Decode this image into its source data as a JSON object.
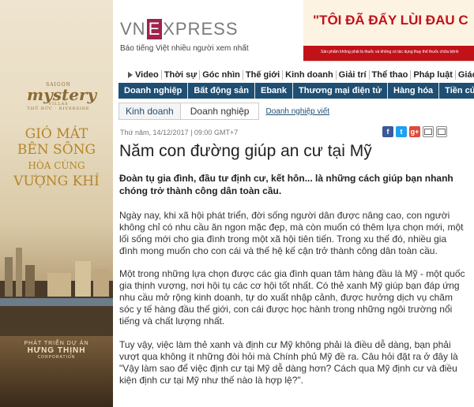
{
  "left_ad": {
    "brand_small": "SAIGON",
    "brand_script": "mystery",
    "brand_tag": "VILLAS",
    "brand_sub": "THỦ ĐỨC · RIVERSIDE",
    "slogan": [
      "GIÓ MÁT",
      "BÊN SÔNG",
      "HÒA CÙNG",
      "VƯỢNG KHÍ"
    ],
    "developer_label": "PHÁT TRIỂN DỰ ÁN",
    "developer_name": "HƯNG THỊNH",
    "developer_sub": "CORPORATION"
  },
  "header": {
    "logo_pre": "VN",
    "logo_box": "E",
    "logo_post": "XPRESS",
    "tagline": "Báo tiếng Việt nhiều người xem nhất"
  },
  "top_ad": {
    "headline": "\"TÔI ĐÃ ĐẨY LÙI ĐAU C",
    "note": "Sản phẩm không phải là thuốc và không có tác dụng thay thế thuốc chữa bệnh"
  },
  "nav": {
    "items": [
      "Video",
      "Thời sự",
      "Góc nhìn",
      "Thế giới",
      "Kinh doanh",
      "Giải trí",
      "Thể thao",
      "Pháp luật",
      "Giáo dục"
    ]
  },
  "subnav": {
    "items": [
      "Doanh nghiệp",
      "Bất động sản",
      "Ebank",
      "Thương mại điện tử",
      "Hàng hóa",
      "Tiền của"
    ]
  },
  "breadcrumb": {
    "section": "Kinh doanh",
    "subsection": "Doanh nghiệp",
    "link": "Doanh nghiệp viết"
  },
  "article": {
    "date": "Thứ năm, 14/12/2017 | 09:00 GMT+7",
    "title": "Năm con đường giúp an cư tại Mỹ",
    "lead": "Đoàn tụ gia đình, đầu tư định cư, kết hôn... là những cách giúp bạn nhanh chóng trở thành công dân toàn cầu.",
    "paragraphs": [
      "Ngày nay, khi xã hội phát triển, đời sống người dân được nâng cao, con người không chỉ có nhu cầu ăn ngon mặc đẹp, mà còn muốn có thêm lựa chọn mới, một lối sống mới cho gia đình trong một xã hội tiên tiến. Trong xu thế đó, nhiều gia đình mong muốn cho con cái và thế hệ kế cận trở thành công dân toàn cầu.",
      "Một trong những lựa chọn được các gia đình quan tâm hàng đầu là Mỹ - một quốc gia thịnh vượng, nơi hội tụ các cơ hội tốt nhất. Có thẻ xanh Mỹ giúp bạn đáp ứng nhu cầu mở rộng kinh doanh, tự do xuất nhập cảnh, được hưởng dịch vụ chăm sóc y tế hàng đầu thế giới, con cái được học hành trong những ngôi trường nổi tiếng và chất lượng nhất.",
      "Tuy vậy, việc làm thẻ xanh và định cư Mỹ không phải là điều dễ dàng, bạn phải vượt qua không ít những đòi hỏi mà Chính phủ Mỹ đề ra. Câu hỏi đặt ra ở đây là \"Vậy làm sao để việc định cư tại Mỹ dễ dàng hơn? Cách qua Mỹ định cư và điều kiện định cư tại Mỹ như thế nào là hợp lệ?\"."
    ]
  },
  "share": {
    "facebook": "f",
    "twitter": "t",
    "google": "g+"
  },
  "colors": {
    "brand": "#9f224e",
    "nav_blue": "#1f4f73",
    "ad_red": "#c1121a"
  }
}
